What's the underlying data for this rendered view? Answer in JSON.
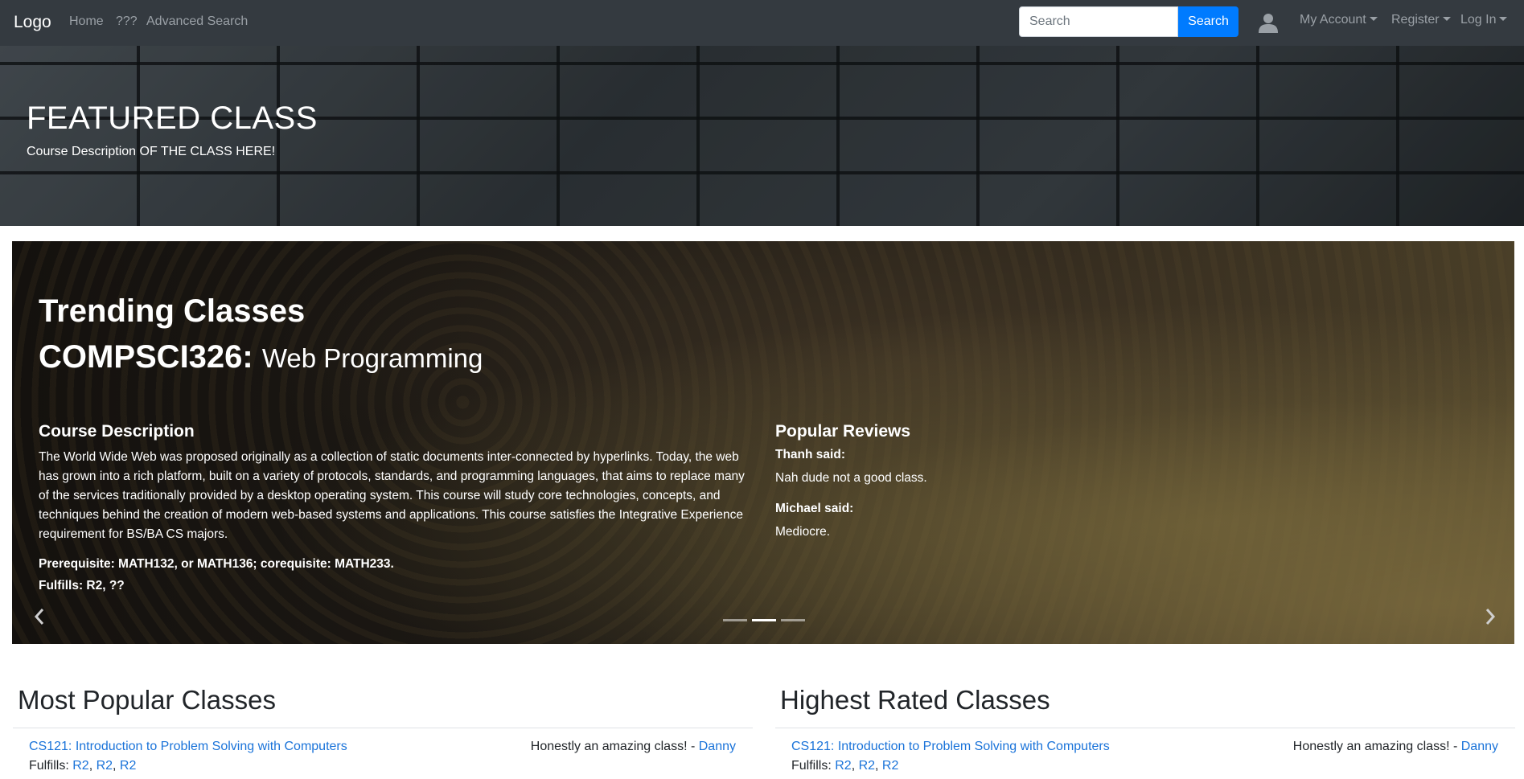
{
  "navbar": {
    "brand": "Logo",
    "links": [
      "Home",
      "???",
      "Advanced Search"
    ],
    "search_placeholder": "Search",
    "search_button": "Search",
    "my_account": "My Account",
    "register": "Register",
    "log_in": "Log In"
  },
  "hero": {
    "title": "FEATURED CLASS",
    "description": "Course Description OF THE CLASS HERE!"
  },
  "carousel": {
    "heading": "Trending Classes",
    "course_code": "COMPSCI326:",
    "course_name": "Web Programming",
    "description_title": "Course Description",
    "description": "The World Wide Web was proposed originally as a collection of static documents inter-connected by hyperlinks. Today, the web has grown into a rich platform, built on a variety of protocols, standards, and programming languages, that aims to replace many of the services traditionally provided by a desktop operating system. This course will study core technologies, concepts, and techniques behind the creation of modern web-based systems and applications. This course satisfies the Integrative Experience requirement for BS/BA CS majors.",
    "prerequisite": "Prerequisite: MATH132, or MATH136; corequisite: MATH233.",
    "fulfills": "Fulfills: R2, ??",
    "reviews_title": "Popular Reviews",
    "reviews": [
      {
        "author": "Thanh said:",
        "text": "Nah dude not a good class."
      },
      {
        "author": "Michael said:",
        "text": "Mediocre."
      }
    ],
    "active_slide": 2,
    "slide_count": 3
  },
  "most_popular": {
    "title": "Most Popular Classes",
    "items": [
      {
        "name": "CS121: Introduction to Problem Solving with Computers",
        "review": "Honestly an amazing class! - ",
        "reviewer": "Danny",
        "fulfills_label": "Fulfills: ",
        "fulfills": [
          "R2",
          "R2",
          "R2"
        ]
      }
    ]
  },
  "highest_rated": {
    "title": "Highest Rated Classes",
    "items": [
      {
        "name": "CS121: Introduction to Problem Solving with Computers",
        "review": "Honestly an amazing class! - ",
        "reviewer": "Danny",
        "fulfills_label": "Fulfills: ",
        "fulfills": [
          "R2",
          "R2",
          "R2"
        ]
      }
    ]
  },
  "colors": {
    "navbar": "#343a40",
    "primary": "#007bff",
    "link": "#1a73d9"
  }
}
